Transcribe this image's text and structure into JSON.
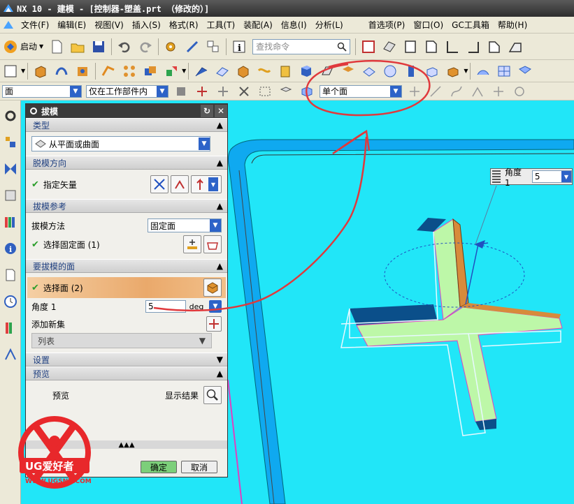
{
  "window": {
    "title": "NX 10 - 建模 - [控制器-塑盖.prt （修改的）]"
  },
  "menubar": {
    "items": [
      "文件(F)",
      "编辑(E)",
      "视图(V)",
      "插入(S)",
      "格式(R)",
      "工具(T)",
      "装配(A)",
      "信息(I)",
      "分析(L)"
    ],
    "right_items": [
      "首选项(P)",
      "窗口(O)",
      "GC工具箱",
      "帮助(H)"
    ]
  },
  "toolbar1": {
    "start_label": "启动",
    "search_placeholder": "查找命令"
  },
  "selection_bar": {
    "filter_value": "面",
    "scope_value": "仅在工作部件内",
    "face_rule_value": "单个面"
  },
  "dialog": {
    "title": "拔模",
    "sections": {
      "type": {
        "header": "类型",
        "value": "从平面或曲面"
      },
      "direction": {
        "header": "脱模方向",
        "label": "指定矢量"
      },
      "reference": {
        "header": "拔模参考",
        "method_label": "拔模方法",
        "method_value": "固定面",
        "select_label": "选择固定面 (1)"
      },
      "faces": {
        "header": "要拔模的面",
        "select_label": "选择面 (2)",
        "angle_label": "角度 1",
        "angle_value": "5",
        "angle_unit": "deg",
        "add_set_label": "添加新集",
        "list_label": "列表"
      },
      "settings": {
        "header": "设置"
      },
      "preview": {
        "header": "预览",
        "preview_label": "预览",
        "show_result_label": "显示结果"
      }
    },
    "buttons": {
      "ok": "确定",
      "cancel": "取消"
    }
  },
  "angle_widget": {
    "label": "角度 1",
    "value": "5"
  },
  "watermark": {
    "brand": "UG爱好者",
    "url": "WWW.UGSNX.COM"
  },
  "colors": {
    "viewport_bg": "#21e6f8",
    "annotation": "#e0393c",
    "part_face": "#bdf7a8",
    "draft_face": "#d78b3b"
  }
}
